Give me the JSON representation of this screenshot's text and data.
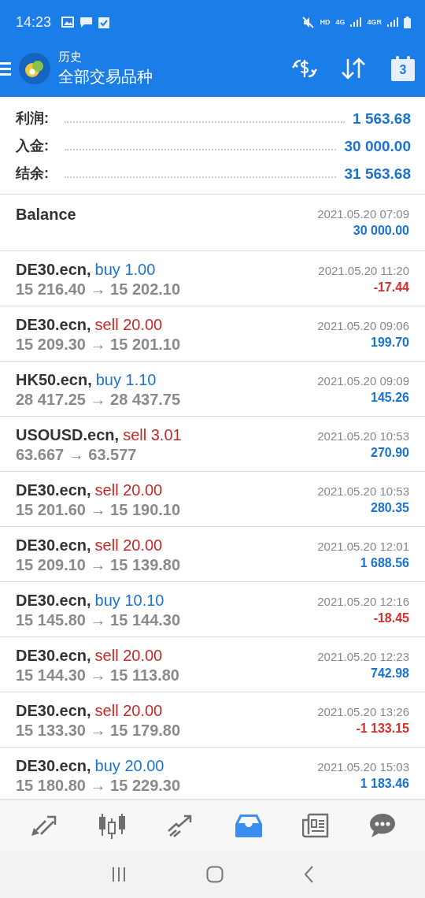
{
  "status_bar": {
    "time": "14:23",
    "hd": "HD",
    "net1": "4G",
    "net2": "4GR"
  },
  "header": {
    "subtitle": "历史",
    "title": "全部交易品种",
    "calendar_day": "3"
  },
  "summary": [
    {
      "label": "利润:",
      "value": "1 563.68"
    },
    {
      "label": "入金:",
      "value": "30 000.00"
    },
    {
      "label": "结余:",
      "value": "31 563.68"
    }
  ],
  "balance": {
    "label": "Balance",
    "time": "2021.05.20 07:09",
    "amount": "30 000.00"
  },
  "trades": [
    {
      "symbol": "DE30.ecn,",
      "side": "buy",
      "volume": "1.00",
      "prices": "15 216.40 → 15 202.10",
      "time": "2021.05.20 11:20",
      "profit": "-17.44",
      "loss": true
    },
    {
      "symbol": "DE30.ecn,",
      "side": "sell",
      "volume": "20.00",
      "prices": "15 209.30 → 15 201.10",
      "time": "2021.05.20 09:06",
      "profit": "199.70",
      "loss": false
    },
    {
      "symbol": "HK50.ecn,",
      "side": "buy",
      "volume": "1.10",
      "prices": "28 417.25 → 28 437.75",
      "time": "2021.05.20 09:09",
      "profit": "145.26",
      "loss": false
    },
    {
      "symbol": "USOUSD.ecn,",
      "side": "sell",
      "volume": "3.01",
      "prices": "63.667 → 63.577",
      "time": "2021.05.20 10:53",
      "profit": "270.90",
      "loss": false
    },
    {
      "symbol": "DE30.ecn,",
      "side": "sell",
      "volume": "20.00",
      "prices": "15 201.60 → 15 190.10",
      "time": "2021.05.20 10:53",
      "profit": "280.35",
      "loss": false
    },
    {
      "symbol": "DE30.ecn,",
      "side": "sell",
      "volume": "20.00",
      "prices": "15 209.10 → 15 139.80",
      "time": "2021.05.20 12:01",
      "profit": "1 688.56",
      "loss": false
    },
    {
      "symbol": "DE30.ecn,",
      "side": "buy",
      "volume": "10.10",
      "prices": "15 145.80 → 15 144.30",
      "time": "2021.05.20 12:16",
      "profit": "-18.45",
      "loss": true
    },
    {
      "symbol": "DE30.ecn,",
      "side": "sell",
      "volume": "20.00",
      "prices": "15 144.30 → 15 113.80",
      "time": "2021.05.20 12:23",
      "profit": "742.98",
      "loss": false
    },
    {
      "symbol": "DE30.ecn,",
      "side": "sell",
      "volume": "20.00",
      "prices": "15 133.30 → 15 179.80",
      "time": "2021.05.20 13:26",
      "profit": "-1 133.15",
      "loss": true
    },
    {
      "symbol": "DE30.ecn,",
      "side": "buy",
      "volume": "20.00",
      "prices": "15 180.80 → 15 229.30",
      "time": "2021.05.20 15:03",
      "profit": "1 183.46",
      "loss": false
    }
  ],
  "bottom_nav": [
    {
      "kind": "quotes",
      "selected": false
    },
    {
      "kind": "chart",
      "selected": false
    },
    {
      "kind": "trade",
      "selected": false
    },
    {
      "kind": "history",
      "selected": true
    },
    {
      "kind": "news",
      "selected": false
    },
    {
      "kind": "chat",
      "selected": false
    }
  ]
}
